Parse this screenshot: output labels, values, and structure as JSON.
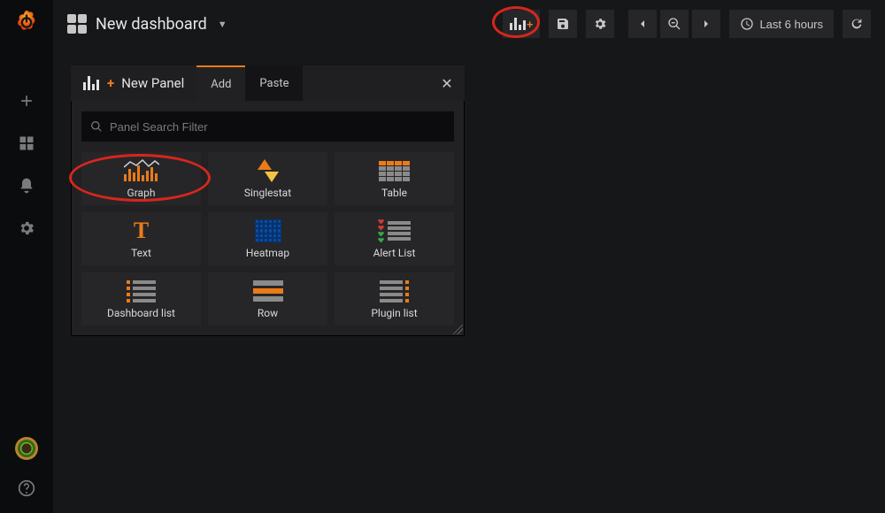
{
  "header": {
    "title": "New dashboard",
    "time_label": "Last 6 hours"
  },
  "picker": {
    "title": "New Panel",
    "tabs": {
      "add": "Add",
      "paste": "Paste"
    },
    "active_tab": "Add",
    "search_placeholder": "Panel Search Filter",
    "types": [
      {
        "id": "graph",
        "label": "Graph"
      },
      {
        "id": "singlestat",
        "label": "Singlestat"
      },
      {
        "id": "table",
        "label": "Table"
      },
      {
        "id": "text",
        "label": "Text"
      },
      {
        "id": "heatmap",
        "label": "Heatmap"
      },
      {
        "id": "alertlist",
        "label": "Alert List"
      },
      {
        "id": "dashlist",
        "label": "Dashboard list"
      },
      {
        "id": "row",
        "label": "Row"
      },
      {
        "id": "pluginlist",
        "label": "Plugin list"
      }
    ]
  },
  "annotations": {
    "circle_add_panel_button": true,
    "circle_graph_type": true
  }
}
